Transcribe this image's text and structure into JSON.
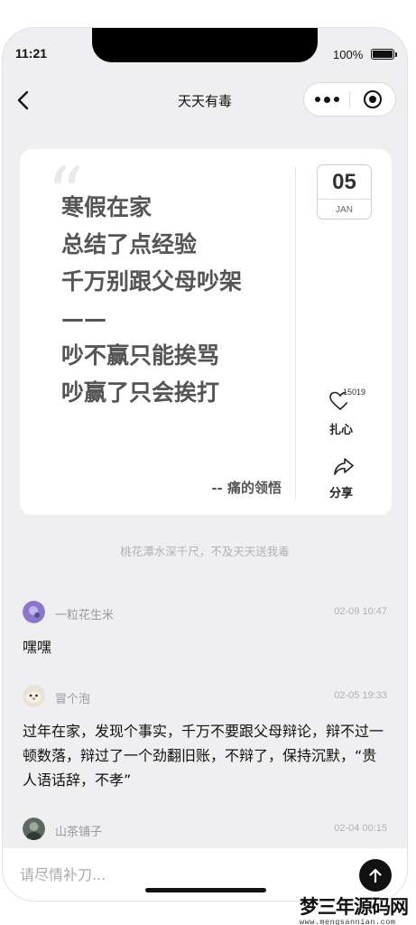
{
  "status_bar": {
    "time": "11:21",
    "battery": "100%"
  },
  "nav": {
    "title": "天天有毒"
  },
  "card": {
    "quote_lines": [
      "寒假在家",
      "总结了点经验",
      "千万别跟父母吵架",
      "——",
      "吵不赢只能挨骂",
      "吵赢了只会挨打"
    ],
    "source": "-- 痛的领悟",
    "date": {
      "day": "05",
      "month": "JAN"
    },
    "like": {
      "count": "15019",
      "label": "扎心"
    },
    "share": {
      "label": "分享"
    }
  },
  "slogan": "桃花潭水深千尺，不及天天送我毒",
  "comments": [
    {
      "name": "一粒花生米",
      "time": "02-09 10:47",
      "text": "嘿嘿"
    },
    {
      "name": "冒个泡",
      "time": "02-05 19:33",
      "text": "过年在家，发现个事实，千万不要跟父母辩论，辩不过一顿数落，辩过了一个劲翻旧账，不辩了，保持沉默，“贵人语话辞，不孝”"
    },
    {
      "name": "山茶铺子",
      "time": "02-04 00:15",
      "text": ""
    }
  ],
  "input": {
    "placeholder": "请尽情补刀..."
  },
  "watermark": {
    "text": "梦三年源码网",
    "url": "www.mengsannian.com"
  }
}
